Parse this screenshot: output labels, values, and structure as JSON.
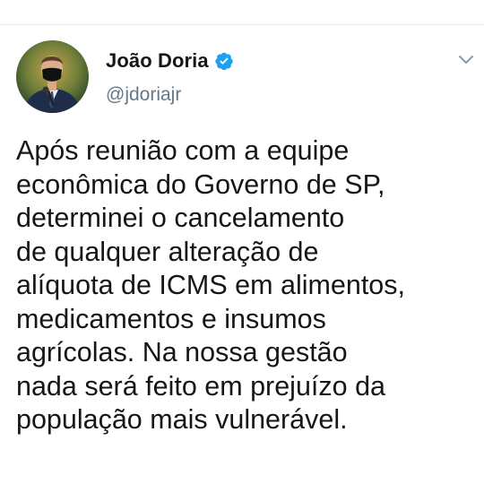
{
  "author": {
    "display_name": "João Doria",
    "handle": "@jdoriajr",
    "verified": true,
    "avatar_icon": "profile-photo-man-in-suit-with-mask"
  },
  "tweet": {
    "text": "Após reunião com a equipe\neconômica do Governo de SP,\ndeterminei o cancelamento\nde qualquer alteração de\nalíquota de ICMS em alimentos,\nmedicamentos e insumos\nagrícolas. Na nossa gestão\nnada será feito em prejuízo da\npopulação mais vulnerável."
  },
  "menu": {
    "icon": "chevron-down-icon"
  },
  "colors": {
    "accent": "#1da1f2",
    "text": "#14171a",
    "secondary": "#657786"
  }
}
